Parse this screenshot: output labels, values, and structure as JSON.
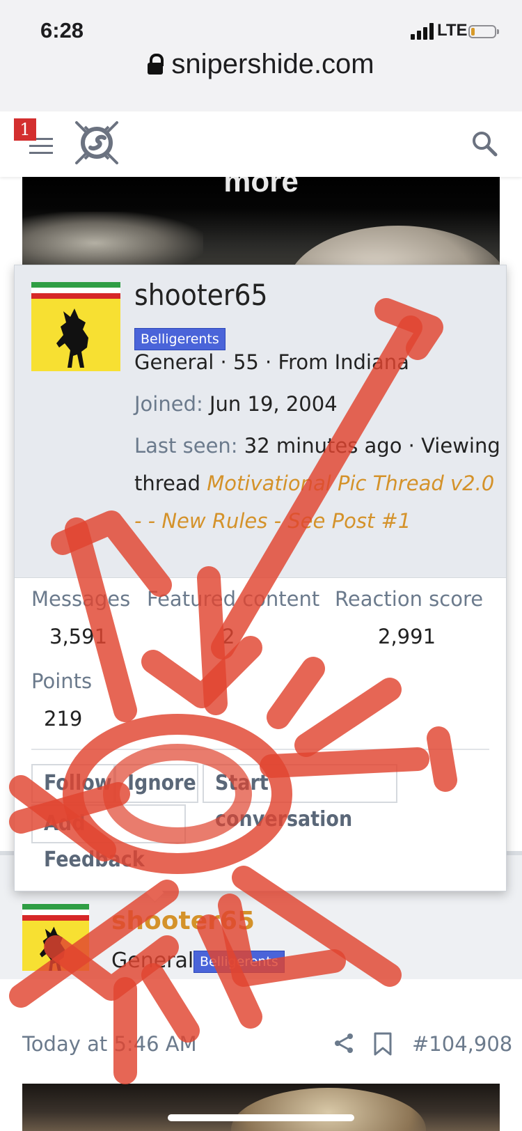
{
  "status_bar": {
    "time": "6:28",
    "network": "LTE"
  },
  "browser": {
    "url": "snipershide.com"
  },
  "header": {
    "notification_count": "1"
  },
  "banner_image": {
    "caption": "more"
  },
  "profile_popup": {
    "username": "shooter65",
    "group": "Belligerents",
    "info_line": "General · 55 · From Indiana",
    "joined_label": "Joined:",
    "joined_value": "Jun 19, 2004",
    "last_seen_label": "Last seen:",
    "last_seen_value": "32 minutes ago · Viewing",
    "thread_prefix": "thread",
    "thread_link_line1": "Motivational Pic Thread v2.0",
    "thread_link_line2": "- - New Rules - See Post #1",
    "stats": {
      "messages_label": "Messages",
      "messages_value": "3,591",
      "featured_label": "Featured content",
      "featured_value": "2",
      "reaction_label": "Reaction score",
      "reaction_value": "2,991",
      "points_label": "Points",
      "points_value": "219"
    },
    "buttons": {
      "follow": "Follow",
      "ignore": "Ignore",
      "start_conversation": "Start conversation",
      "add_feedback": "Add Feedback"
    }
  },
  "post": {
    "username": "shooter65",
    "title": "General",
    "group": "Belligerents",
    "timestamp": "Today at 5:46 AM",
    "post_number": "#104,908"
  },
  "icons": {
    "menu": "hamburger-menu-icon",
    "logo": "snipershide-logo-icon",
    "search": "search-icon",
    "lock": "lock-icon",
    "share": "share-icon",
    "bookmark": "bookmark-icon"
  },
  "colors": {
    "accent_link": "#d4922a",
    "badge_blue": "#4a64d9",
    "notification_red": "#d32f2f",
    "scribble_red": "#e0442f"
  }
}
